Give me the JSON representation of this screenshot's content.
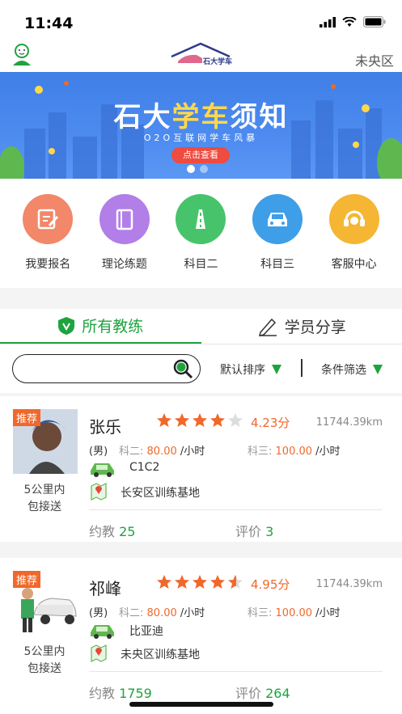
{
  "status_bar": {
    "time": "11:44"
  },
  "header": {
    "logo_text": "石大学车",
    "location": "未央区"
  },
  "banner": {
    "title_white": "石大",
    "title_yellow": "学车",
    "title_white2": "须知",
    "subtitle": "O2O互联网学车风暴",
    "button_label": "点击查看"
  },
  "quick_menu": [
    {
      "label": "我要报名",
      "color": "#f2876a"
    },
    {
      "label": "理论练题",
      "color": "#b27ee8"
    },
    {
      "label": "科目二",
      "color": "#47c46b"
    },
    {
      "label": "科目三",
      "color": "#3f9ee8"
    },
    {
      "label": "客服中心",
      "color": "#f5b634"
    }
  ],
  "tabs": {
    "all_coaches": "所有教练",
    "student_share": "学员分享"
  },
  "filter": {
    "search_placeholder": "",
    "sort_label": "默认排序",
    "condition_label": "条件筛选"
  },
  "coaches": [
    {
      "badge": "推荐",
      "pickup_line1": "5公里内",
      "pickup_line2": "包接送",
      "name": "张乐",
      "rating": "4.23分",
      "stars": 4,
      "distance": "11744.39km",
      "gender": "(男)",
      "k2_label": "科二:",
      "k2_price": "80.00",
      "k3_label": "科三:",
      "k3_price": "100.00",
      "unit": "/小时",
      "car": "C1C2",
      "base": "长安区训练基地",
      "appointments_label": "约教",
      "appointments": "25",
      "reviews_label": "评价",
      "reviews": "3"
    },
    {
      "badge": "推荐",
      "pickup_line1": "5公里内",
      "pickup_line2": "包接送",
      "name": "祁峰",
      "rating": "4.95分",
      "stars": 4.5,
      "distance": "11744.39km",
      "gender": "(男)",
      "k2_label": "科二:",
      "k2_price": "80.00",
      "k3_label": "科三:",
      "k3_price": "100.00",
      "unit": "/小时",
      "car": "比亚迪",
      "base": "未央区训练基地",
      "appointments_label": "约教",
      "appointments": "1759",
      "reviews_label": "评价",
      "reviews": "264"
    }
  ]
}
